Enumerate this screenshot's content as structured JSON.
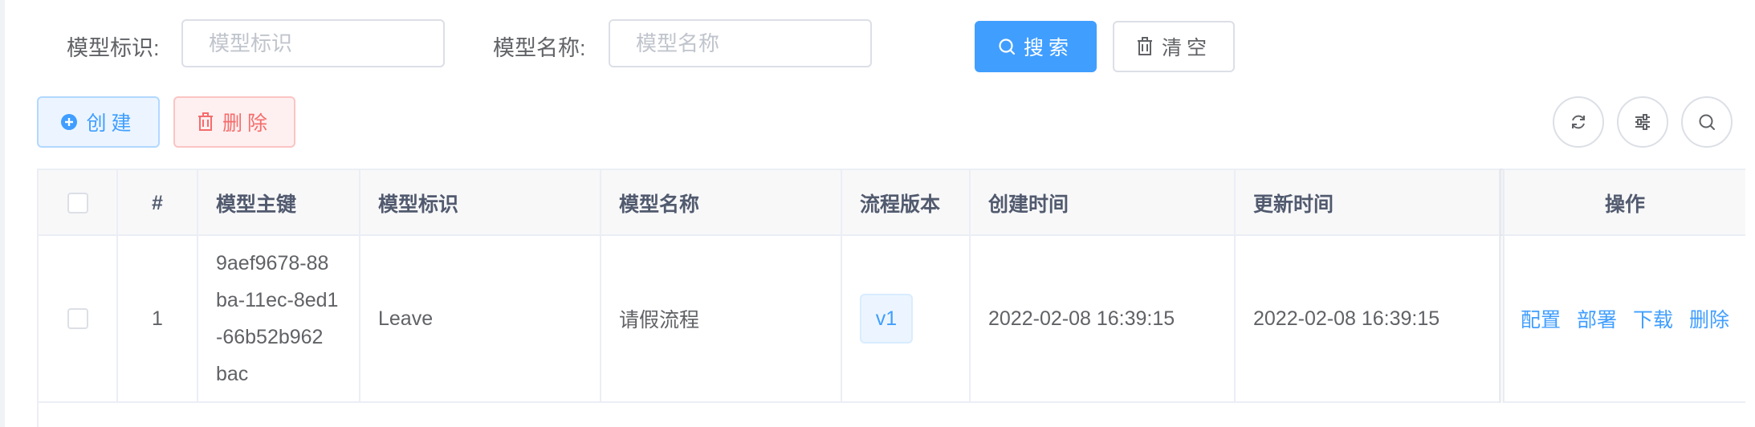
{
  "search": {
    "model_key_label": "模型标识:",
    "model_key_placeholder": "模型标识",
    "model_name_label": "模型名称:",
    "model_name_placeholder": "模型名称",
    "search_button": "搜索",
    "clear_button": "清空"
  },
  "toolbar": {
    "create_button": "创建",
    "delete_button": "删除",
    "icons": [
      "refresh-icon",
      "columns-settings-icon",
      "search-toggle-icon"
    ]
  },
  "colors": {
    "primary": "#409eff",
    "danger": "#f56c6c",
    "border": "#dcdfe6"
  },
  "table": {
    "headers": {
      "index": "#",
      "id": "模型主键",
      "key": "模型标识",
      "name": "模型名称",
      "version": "流程版本",
      "created": "创建时间",
      "updated": "更新时间",
      "actions": "操作"
    },
    "rows": [
      {
        "index": "1",
        "id_lines": [
          "9aef9678-88",
          "ba-11ec-8ed1",
          "-66b52b962",
          "bac"
        ],
        "key": "Leave",
        "name": "请假流程",
        "version": "v1",
        "created": "2022-02-08 16:39:15",
        "updated": "2022-02-08 16:39:15",
        "actions": {
          "config": "配置",
          "deploy": "部署",
          "download": "下载",
          "delete": "删除"
        }
      }
    ]
  }
}
